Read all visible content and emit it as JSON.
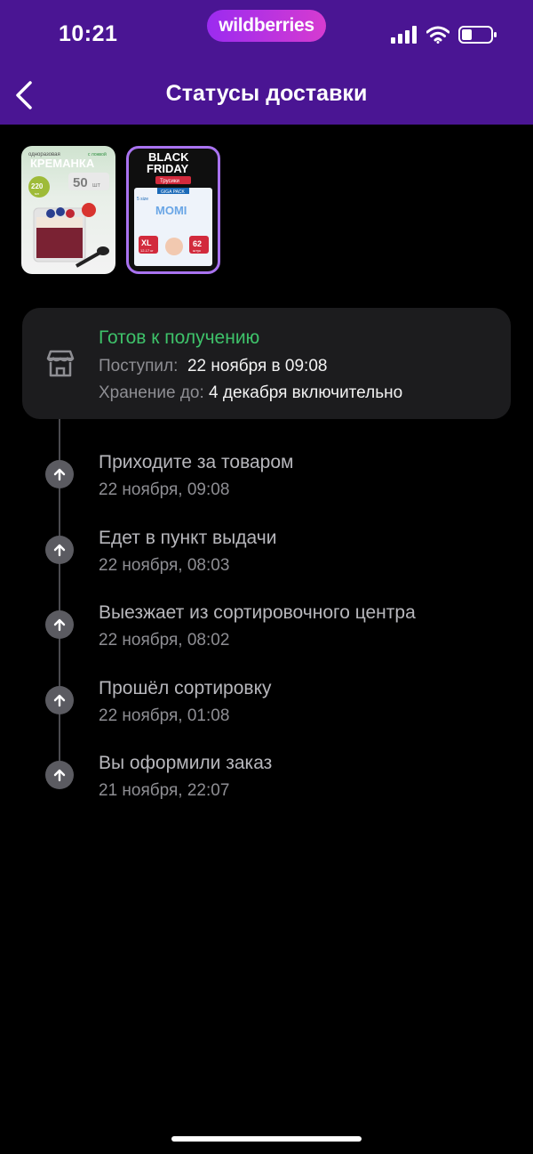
{
  "status_bar": {
    "time": "10:21",
    "brand": "wildberries"
  },
  "header": {
    "title": "Статусы доставки"
  },
  "products": [
    {
      "name": "Креманка",
      "text_top": "одноразовая",
      "text_badge": "с ложкой",
      "title": "КРЕМАНКА",
      "count": "50",
      "count_unit": "шт",
      "volume": "220",
      "volume_unit": "мл"
    },
    {
      "name": "Momi",
      "promo_line1": "BLACK",
      "promo_line2": "FRIDAY",
      "sub": "Трусики",
      "pack": "GIGA PACK",
      "size_badge": "5 size",
      "logo": "MOMI",
      "size": "XL",
      "weight": "12-17 кг",
      "count": "62",
      "count_unit": "штук"
    }
  ],
  "current_status": {
    "title": "Готов к получению",
    "arrived_label": "Поступил:",
    "arrived_value": "22 ноября в 09:08",
    "storage_label": "Хранение до:",
    "storage_value": "4 декабря включительно",
    "color": "#3ec26a"
  },
  "events": [
    {
      "title": "Приходите за товаром",
      "date": "22 ноября, 09:08"
    },
    {
      "title": "Едет в пункт выдачи",
      "date": "22 ноября, 08:03"
    },
    {
      "title": "Выезжает из сортировочного центра",
      "date": "22 ноября, 08:02"
    },
    {
      "title": "Прошёл сортировку",
      "date": "22 ноября, 01:08"
    },
    {
      "title": "Вы оформили заказ",
      "date": "21 ноября, 22:07"
    }
  ],
  "colors": {
    "header": "#4a1593",
    "accent": "#a973f0"
  }
}
